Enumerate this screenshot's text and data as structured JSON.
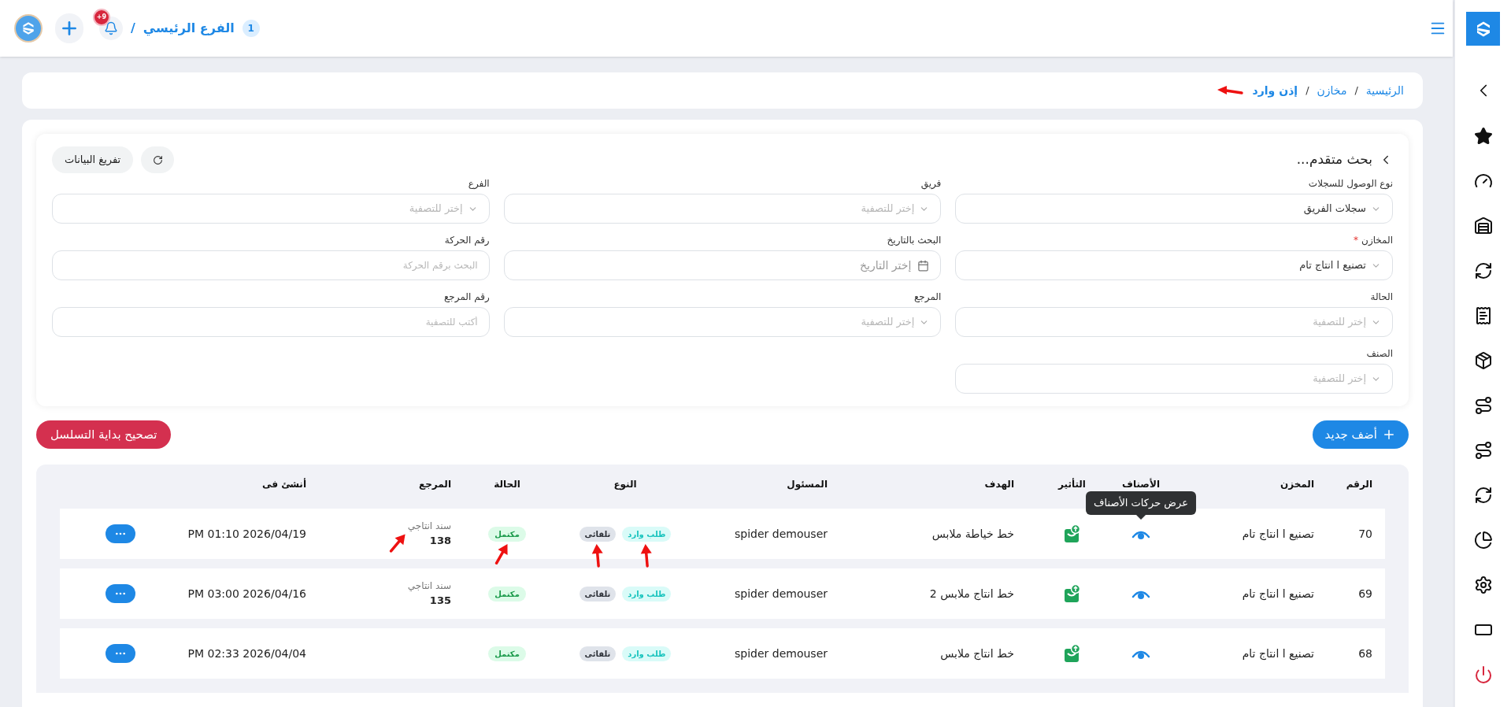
{
  "header": {
    "branch_number": "1",
    "branch_name": "الفرع الرئيسي",
    "separator": "/",
    "notifications_badge": "+9"
  },
  "breadcrumb": {
    "separator": "/",
    "items": [
      {
        "label": "الرئيسية",
        "current": false
      },
      {
        "label": "مخازن",
        "current": false
      },
      {
        "label": "إذن وارد",
        "current": true
      }
    ]
  },
  "filters": {
    "title": "بحث متقدم...",
    "clear_button": "تفريغ البيانات",
    "fields": [
      {
        "label": "نوع الوصول للسجلات",
        "kind": "select",
        "value": "سجلات الفريق"
      },
      {
        "label": "فريق",
        "kind": "select",
        "placeholder": "إختر للتصفية"
      },
      {
        "label": "الفرع",
        "kind": "select",
        "placeholder": "إختر للتصفية"
      },
      {
        "label": "المخازن",
        "kind": "select",
        "value": "تصنيع ا انتاج تام",
        "required_mark": "*"
      },
      {
        "label": "البحث بالتاريخ",
        "kind": "date",
        "placeholder": "إختر التاريخ"
      },
      {
        "label": "رقم الحركة",
        "kind": "text",
        "placeholder": "البحث برقم الحركة"
      },
      {
        "label": "الحالة",
        "kind": "select",
        "placeholder": "إختر للتصفية"
      },
      {
        "label": "المرجع",
        "kind": "select",
        "placeholder": "إختر للتصفية"
      },
      {
        "label": "رقم المرجع",
        "kind": "text",
        "placeholder": "أكتب للتصفية"
      },
      {
        "label": "الصنف",
        "kind": "select",
        "placeholder": "إختر للتصفية"
      }
    ]
  },
  "add_button": "أضف جديد",
  "fix_sequence_button": "تصحيح بداية التسلسل",
  "table": {
    "columns": [
      "الرقم",
      "المخزن",
      "الأصناف",
      "التأثير",
      "الهدف",
      "المسئول",
      "النوع",
      "الحالة",
      "المرجع",
      "أنشئ فى"
    ],
    "tooltip": "عرض حركات الأصناف",
    "rows": [
      {
        "number": "70",
        "store": "تصنيع ا انتاج تام",
        "target": "خط خياطة ملابس",
        "responsible": "spider demouser",
        "types": [
          {
            "label": "طلب وارد",
            "kind": "request"
          },
          {
            "label": "تلقائى",
            "kind": "auto"
          }
        ],
        "status": "مكتمل",
        "reference_label": "سند انتاجي",
        "reference_number": "138",
        "created": "PM 01:10 2026/04/19",
        "marked": true
      },
      {
        "number": "69",
        "store": "تصنيع ا انتاج تام",
        "target": "خط انتاج ملابس 2",
        "responsible": "spider demouser",
        "types": [
          {
            "label": "طلب وارد",
            "kind": "request"
          },
          {
            "label": "تلقائى",
            "kind": "auto"
          }
        ],
        "status": "مكتمل",
        "reference_label": "سند انتاجي",
        "reference_number": "135",
        "created": "PM 03:00 2026/04/16",
        "marked": false
      },
      {
        "number": "68",
        "store": "تصنيع ا انتاج تام",
        "target": "خط انتاج ملابس",
        "responsible": "spider demouser",
        "types": [
          {
            "label": "طلب وارد",
            "kind": "request"
          },
          {
            "label": "تلقائى",
            "kind": "auto"
          }
        ],
        "status": "مكتمل",
        "created": "PM 02:33 2026/04/04",
        "marked": false
      }
    ]
  }
}
